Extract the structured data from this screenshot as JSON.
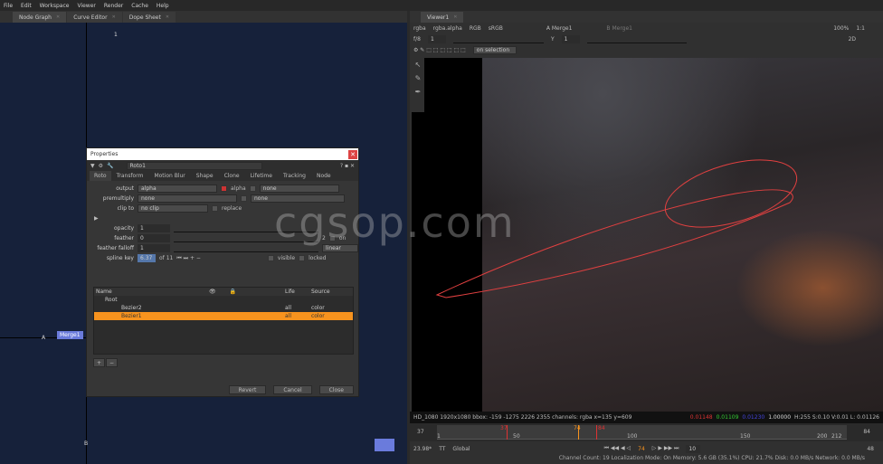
{
  "menu": [
    "File",
    "Edit",
    "Workspace",
    "Viewer",
    "Render",
    "Cache",
    "Help"
  ],
  "left_tabs": [
    {
      "label": "Node Graph"
    },
    {
      "label": "Curve Editor"
    },
    {
      "label": "Dope Sheet"
    }
  ],
  "nodegraph": {
    "node_label": "Merge1",
    "input_a": "A",
    "input_b": "B",
    "input_1": "1"
  },
  "properties": {
    "title": "Properties",
    "node_name": "Roto1",
    "tabs": [
      "Roto",
      "Transform",
      "Motion Blur",
      "Shape",
      "Clone",
      "Lifetime",
      "Tracking",
      "Node"
    ],
    "output_label": "output",
    "output_value": "alpha",
    "alpha_label": "alpha",
    "output_extra": "none",
    "premultiply_label": "premultiply",
    "premultiply_value": "none",
    "premultiply_extra": "none",
    "clipto_label": "clip to",
    "clipto_value": "no clip",
    "replace_label": "replace",
    "opacity_label": "opacity",
    "opacity_value": "1",
    "feather_label": "feather",
    "feather_value": "0",
    "feather_on": "on",
    "feather_count": "2",
    "falloff_label": "feather falloff",
    "falloff_value": "1",
    "falloff_type": "linear",
    "splinekey_label": "spline key",
    "splinekey_value": "6.37",
    "splinekey_of": "of 11",
    "visible_label": "visible",
    "locked_label": "locked",
    "columns": [
      "Name",
      "",
      "",
      "",
      "",
      "",
      "",
      "",
      "Life",
      "Source"
    ],
    "rows": [
      {
        "name": "Root",
        "life": "",
        "source": "",
        "selected": false
      },
      {
        "name": "Bezier2",
        "life": "all",
        "source": "color",
        "selected": false
      },
      {
        "name": "Bezier1",
        "life": "all",
        "source": "color",
        "selected": true
      }
    ],
    "add": "+",
    "remove": "−",
    "revert": "Revert",
    "cancel": "Cancel",
    "close": "Close",
    "accent": "#f7931e"
  },
  "viewer": {
    "tab": "Viewer1",
    "channels": "rgba",
    "layer": "rgba.alpha",
    "display": "RGB",
    "colorspace": "sRGB",
    "input_a": "A  Merge1",
    "input_b": "B  Merge1",
    "zoom": "100%",
    "ratio": "1:1",
    "fstop": "f/8",
    "frame": "1",
    "y_label": "Y",
    "y_value": "1",
    "view_mode": "2D",
    "selection_mode": "on selection",
    "info": "HD_1080 1920x1080  bbox: -159 -1275 2226 2355 channels: rgba  x=135 y=609",
    "pixel": {
      "r": "0.01148",
      "g": "0.01109",
      "b": "0.01230",
      "a": "1.00000"
    },
    "hsv": "H:255 S:0.10 V:0.01  L: 0.01126",
    "timeline": {
      "start": "37",
      "end": "84",
      "ticks": [
        "1",
        "50",
        "100",
        "150",
        "200",
        "212"
      ],
      "in": "37",
      "current": "74",
      "out": "84"
    },
    "fps": "23.98*",
    "tt": "TT",
    "global": "Global",
    "frame_display": "74",
    "step": "10",
    "frame_count": "48",
    "status": "Channel Count: 19 Localization Mode: On Memory: 5.6 GB (35.1%) CPU: 21.7% Disk: 0.0 MB/s Network: 0.0 MB/s"
  },
  "watermark": "cgsop.com"
}
